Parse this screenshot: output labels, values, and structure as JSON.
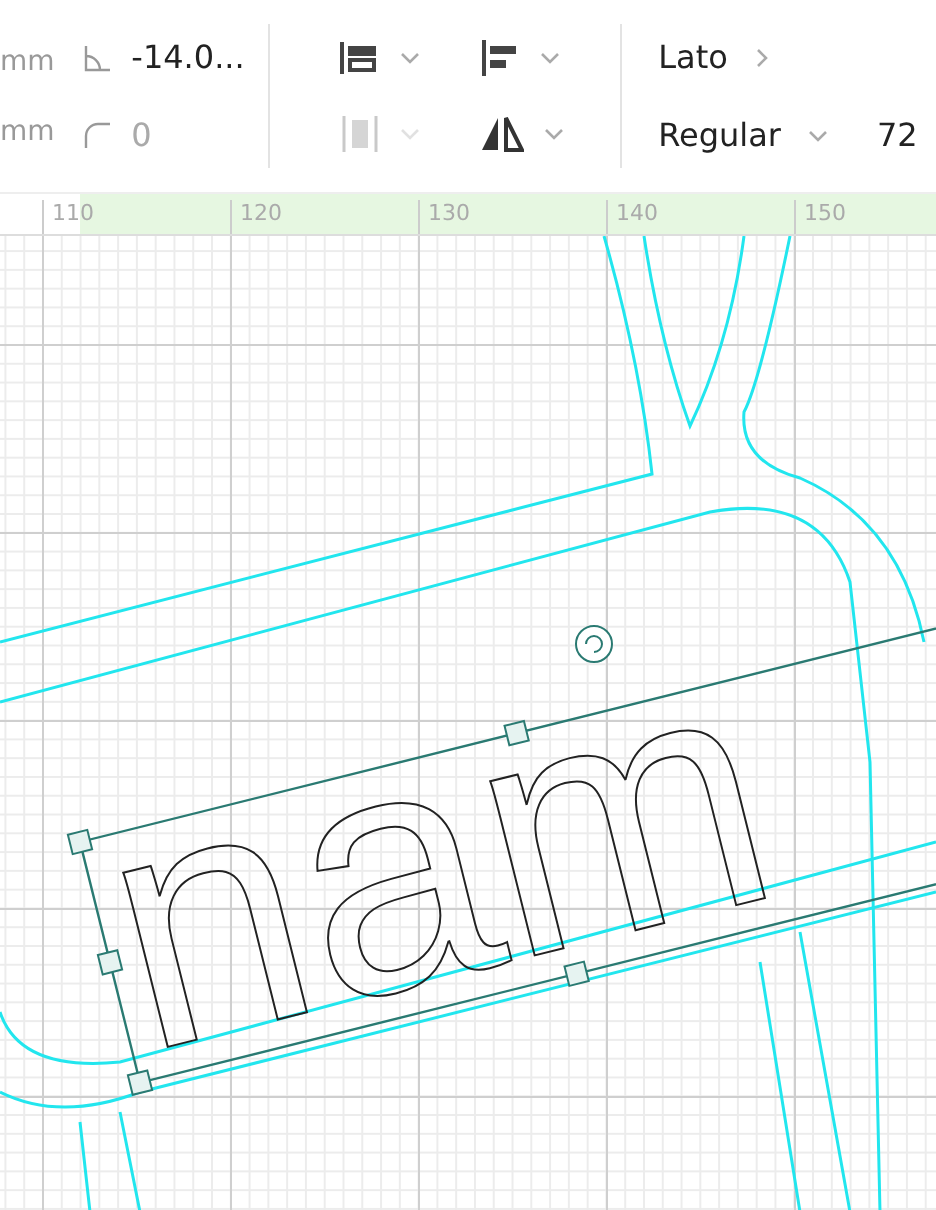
{
  "toolbar": {
    "width_unit": "mm",
    "height_unit": "mm",
    "rotation": {
      "value": "-14.0...",
      "disabled": false
    },
    "corner_radius": {
      "value": "0",
      "disabled": true
    },
    "tools": [
      {
        "kind": "align",
        "disabled": false
      },
      {
        "kind": "justify",
        "disabled": false
      },
      {
        "kind": "distribute",
        "disabled": true
      },
      {
        "kind": "flip",
        "disabled": false
      }
    ],
    "font": {
      "family": "Lato",
      "style": "Regular",
      "size": "72"
    }
  },
  "ruler": {
    "ticks": [
      "110",
      "120",
      "130",
      "140",
      "150"
    ]
  },
  "canvas": {
    "text_object": {
      "text": "nam",
      "selected": true
    }
  }
}
